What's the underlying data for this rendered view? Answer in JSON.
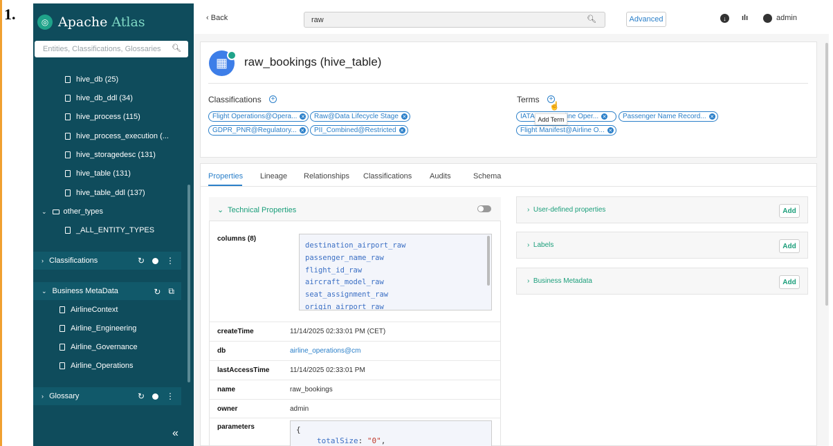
{
  "step_number": "1.",
  "app": {
    "logo_name": "Apache",
    "logo_accent": "Atlas"
  },
  "sidebar": {
    "search_placeholder": "Entities, Classifications, Glossaries",
    "entity_types": [
      {
        "label": "hive_db (25)"
      },
      {
        "label": "hive_db_ddl (34)"
      },
      {
        "label": "hive_process (115)"
      },
      {
        "label": "hive_process_execution (..."
      },
      {
        "label": "hive_storagedesc (131)"
      },
      {
        "label": "hive_table (131)"
      },
      {
        "label": "hive_table_ddl (137)"
      }
    ],
    "other_types_label": "other_types",
    "all_entity_types_label": "_ALL_ENTITY_TYPES",
    "classifications_label": "Classifications",
    "business_metadata_label": "Business MetaData",
    "business_metadata_items": [
      {
        "label": "AirlineContext"
      },
      {
        "label": "Airline_Engineering"
      },
      {
        "label": "Airline_Governance"
      },
      {
        "label": "Airline_Operations"
      }
    ],
    "glossary_label": "Glossary"
  },
  "topbar": {
    "back_label": "Back",
    "search_value": "raw",
    "advanced_label": "Advanced",
    "user_label": "admin"
  },
  "entity": {
    "title": "raw_bookings (hive_table)",
    "classifications_label": "Classifications",
    "terms_label": "Terms",
    "classifications": [
      {
        "label": "Flight Operations@Opera..."
      },
      {
        "label": "Raw@Data Lifecycle Stage"
      },
      {
        "label": "GDPR_PNR@Regulatory..."
      },
      {
        "label": "PII_Combined@Restricted"
      }
    ],
    "terms": [
      {
        "label": "IATA"
      },
      {
        "label": "line Oper..."
      },
      {
        "label": "Passenger Name Record..."
      },
      {
        "label": "Flight Manifest@Airline O..."
      }
    ],
    "tooltip": "Add Term"
  },
  "tabs": [
    {
      "label": "Properties",
      "active": true
    },
    {
      "label": "Lineage"
    },
    {
      "label": "Relationships"
    },
    {
      "label": "Classifications"
    },
    {
      "label": "Audits"
    },
    {
      "label": "Schema"
    }
  ],
  "technical_properties": {
    "title": "Technical Properties",
    "columns_key": "columns (8)",
    "columns": [
      "destination_airport_raw",
      "passenger_name_raw",
      "flight_id_raw",
      "aircraft_model_raw",
      "seat_assignment_raw",
      "origin_airport_raw"
    ],
    "rows": [
      {
        "key": "createTime",
        "value": "11/14/2025 02:33:01 PM (CET)"
      },
      {
        "key": "db",
        "value": "airline_operations@cm"
      },
      {
        "key": "lastAccessTime",
        "value": "11/14/2025 02:33:01 PM"
      },
      {
        "key": "name",
        "value": "raw_bookings"
      },
      {
        "key": "owner",
        "value": "admin"
      }
    ],
    "parameters_key": "parameters",
    "parameters_open": "{",
    "parameters_line_key": "totalSize",
    "parameters_line_value": "\"0\""
  },
  "right_panels": {
    "add_label": "Add",
    "panels": [
      {
        "title": "User-defined properties"
      },
      {
        "title": "Labels"
      },
      {
        "title": "Business Metadata"
      }
    ]
  },
  "colors": {
    "sidebar_bg": "#0f4c5c",
    "accent_blue": "#2a7fc9",
    "accent_green": "#1a9e7a"
  }
}
